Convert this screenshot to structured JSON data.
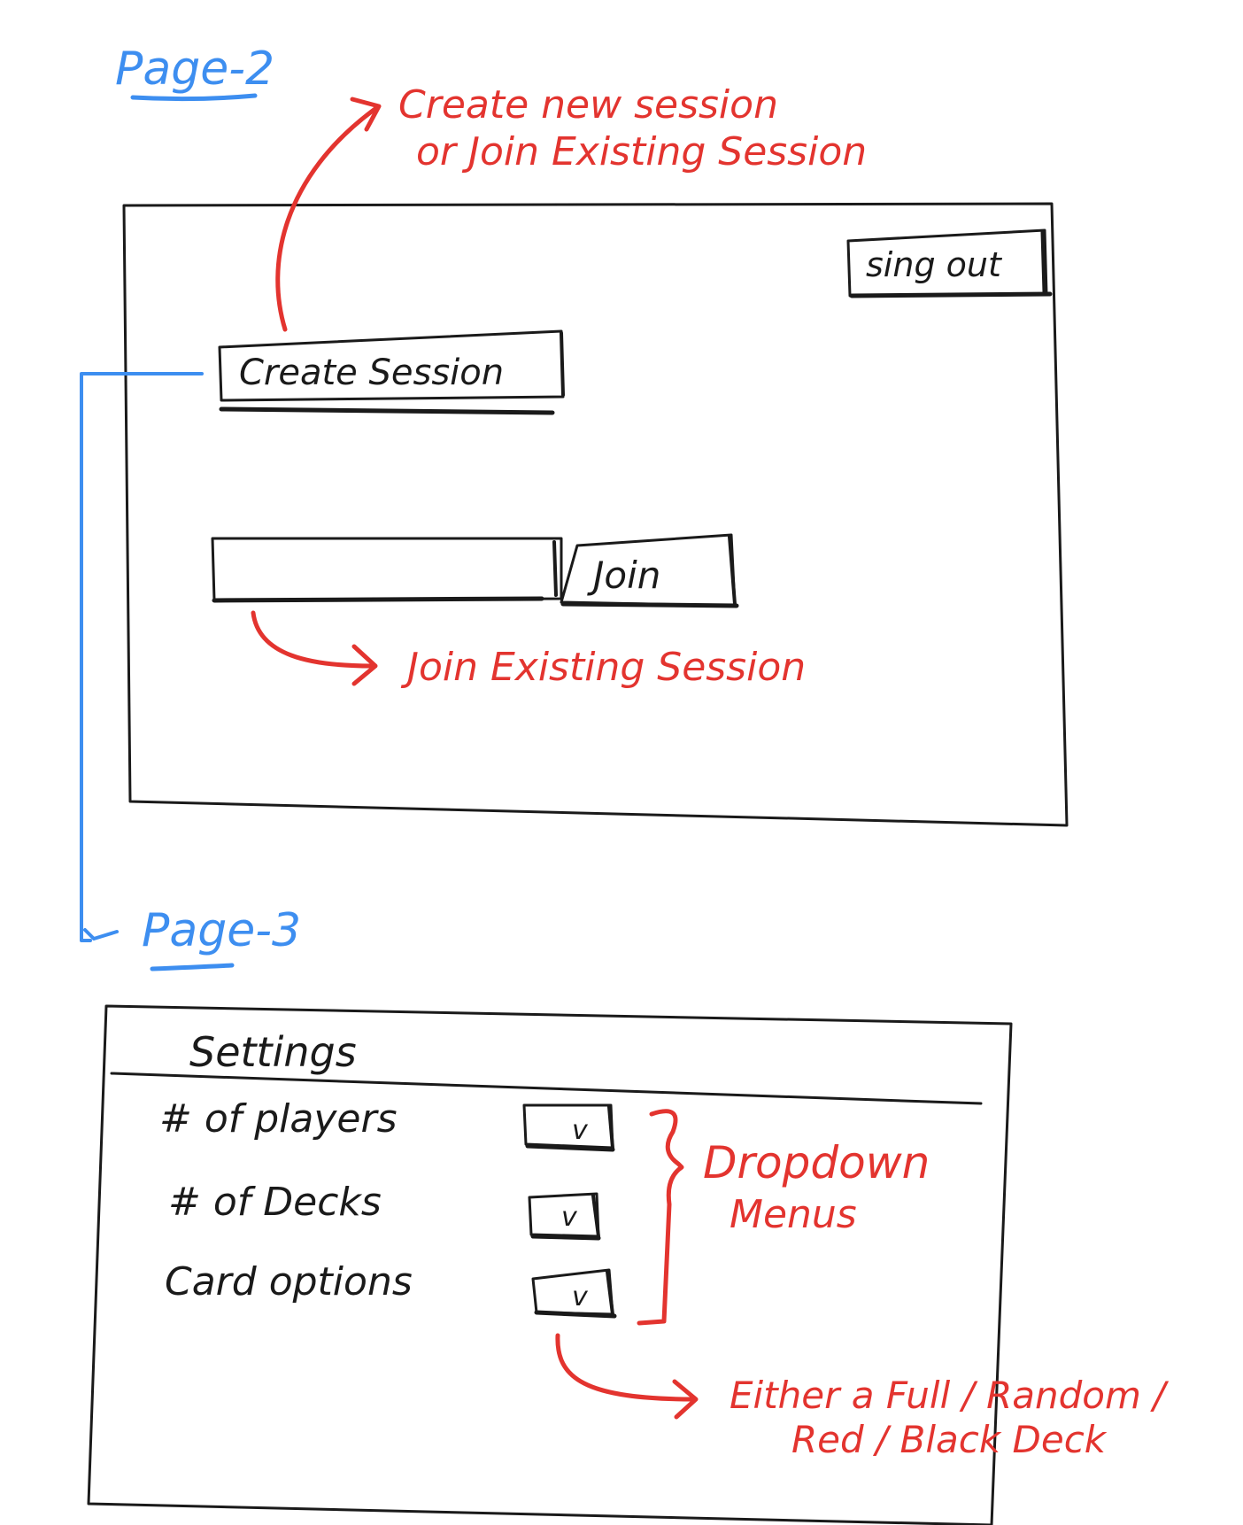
{
  "page2": {
    "title": "Page-2",
    "signout_label": "sing out",
    "create_session_label": "Create Session",
    "join_input_value": "",
    "join_label": "Join"
  },
  "page3": {
    "title": "Page-3",
    "settings_heading": "Settings",
    "settings": [
      {
        "label": "# of players",
        "dropdown": "v"
      },
      {
        "label": "# of Decks",
        "dropdown": "v"
      },
      {
        "label": "Card options",
        "dropdown": "v"
      }
    ]
  },
  "annotations": {
    "create_note_line1": "Create new session",
    "create_note_line2": "or Join Existing Session",
    "join_note": "Join Existing Session",
    "dropdown_note_line1": "Dropdown",
    "dropdown_note_line2": "Menus",
    "card_note_line1": "Either a Full / Random /",
    "card_note_line2": "Red / Black Deck"
  },
  "colors": {
    "ink": "#1a1a1a",
    "annotation": "#e3342f",
    "page_link": "#3d8ef0"
  }
}
